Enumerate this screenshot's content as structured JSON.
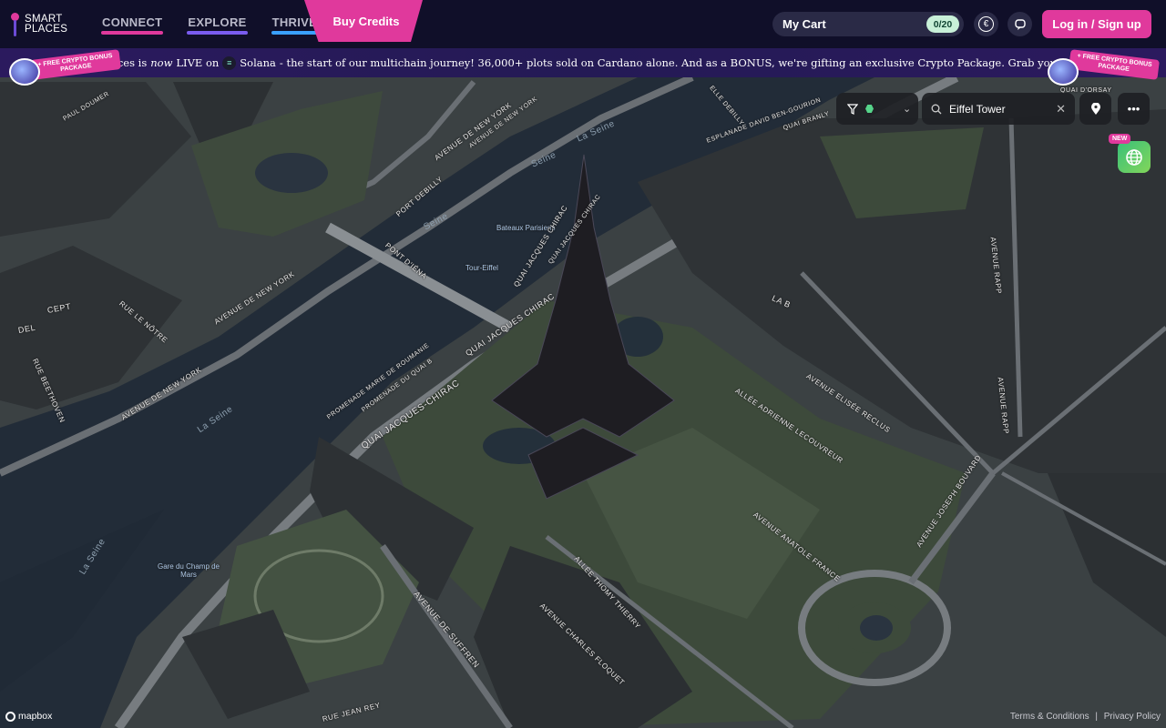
{
  "header": {
    "logo_line1": "SMART",
    "logo_line2": "PLACES",
    "nav": [
      {
        "label": "CONNECT",
        "color": "#e0399c"
      },
      {
        "label": "EXPLORE",
        "color": "#7a5cf0"
      },
      {
        "label": "THRIVE",
        "color": "#3aa0ff"
      }
    ],
    "buy_credits": "Buy Credits",
    "cart_label": "My Cart",
    "cart_count": "0/20",
    "currency_icon": "€",
    "chat_icon": "chat-icon",
    "login": "Log in / Sign up"
  },
  "announcement": {
    "pre": "SmartPlaces is",
    "emph": "now",
    "live": "LIVE on",
    "chain": "Solana",
    "rest": "- the start of our multichain journey! 36,000+ plots sold on Cardano alone. And as a BONUS, we're gifting an exclusive Crypto Package. Grab yours here.",
    "promo_text": "+ FREE CRYPTO BONUS PACKAGE"
  },
  "map_controls": {
    "search_value": "Eiffel Tower",
    "new_badge": "NEW"
  },
  "map_labels": {
    "avenue_new_york_1": "AVENUE DE NEW YORK",
    "avenue_new_york_2": "AVENUE DE NEW YORK",
    "avenue_new_york_3": "AVENUE DE NEW YORK",
    "avenue_new_york_4": "AVENUE DE NEW YORK",
    "port_debilly": "PORT DEBILLY",
    "pont_iena": "PONT D'IÉNA",
    "seine_1": "Seine",
    "seine_2": "Seine",
    "seine_3": "La Seine",
    "seine_4": "Seine",
    "seine_5": "La Seine",
    "seine_6": "La Seine",
    "bateaux": "Bateaux Parisiens",
    "tour_eiffel": "Tour-Eiffel",
    "promenade_quai_1": "PROMENADE DU QUAI B",
    "quai_chirac_1": "QUAI JACQUES CHIRAC",
    "quai_chirac_2": "QUAI JACQUES CHIRAC",
    "quai_chirac_3": "QUAI JACQUES CHIRAC",
    "quai_chirac_4": "QUAI JACQUES-CHIRAC",
    "promenade_roumanie": "PROMENADE MARIE DE ROUMANIE",
    "esplanade": "ESPLANADE DAVID BEN-GOURION",
    "quai_branly": "QUAI BRANLY",
    "avenue_rapp_1": "AVENUE RAPP",
    "avenue_rapp_2": "AVENUE RAPP",
    "allee_lecouvreur": "ALLÉE ADRIENNE LECOUVREUR",
    "avenue_elisee": "AVENUE ELISÉE RECLUS",
    "avenue_anatole": "AVENUE ANATOLE FRANCE",
    "avenue_bouvard": "AVENUE JOSEPH BOUVARD",
    "allee_thierry": "ALLÉE THOMY THIERRY",
    "avenue_floquet": "AVENUE CHARLES FLOQUET",
    "avenue_suffren": "AVENUE DE SUFFREN",
    "rue_notre": "RUE LE NÔTRE",
    "rue_beethoven": "RUE BEETHOVEN",
    "paul_doumer": "PAUL DOUMER",
    "gare": "Gare du Champ de Mars",
    "jean_rey": "RUE JEAN REY",
    "quai_orsay": "QUAI D'ORSAY",
    "debilly_2": "ELLE DEBILLY",
    "la_b": "LA B",
    "del": "DEL",
    "cept": "CEPT"
  },
  "footer": {
    "mapbox": "mapbox",
    "terms": "Terms & Conditions",
    "sep": "|",
    "privacy": "Privacy Policy"
  }
}
